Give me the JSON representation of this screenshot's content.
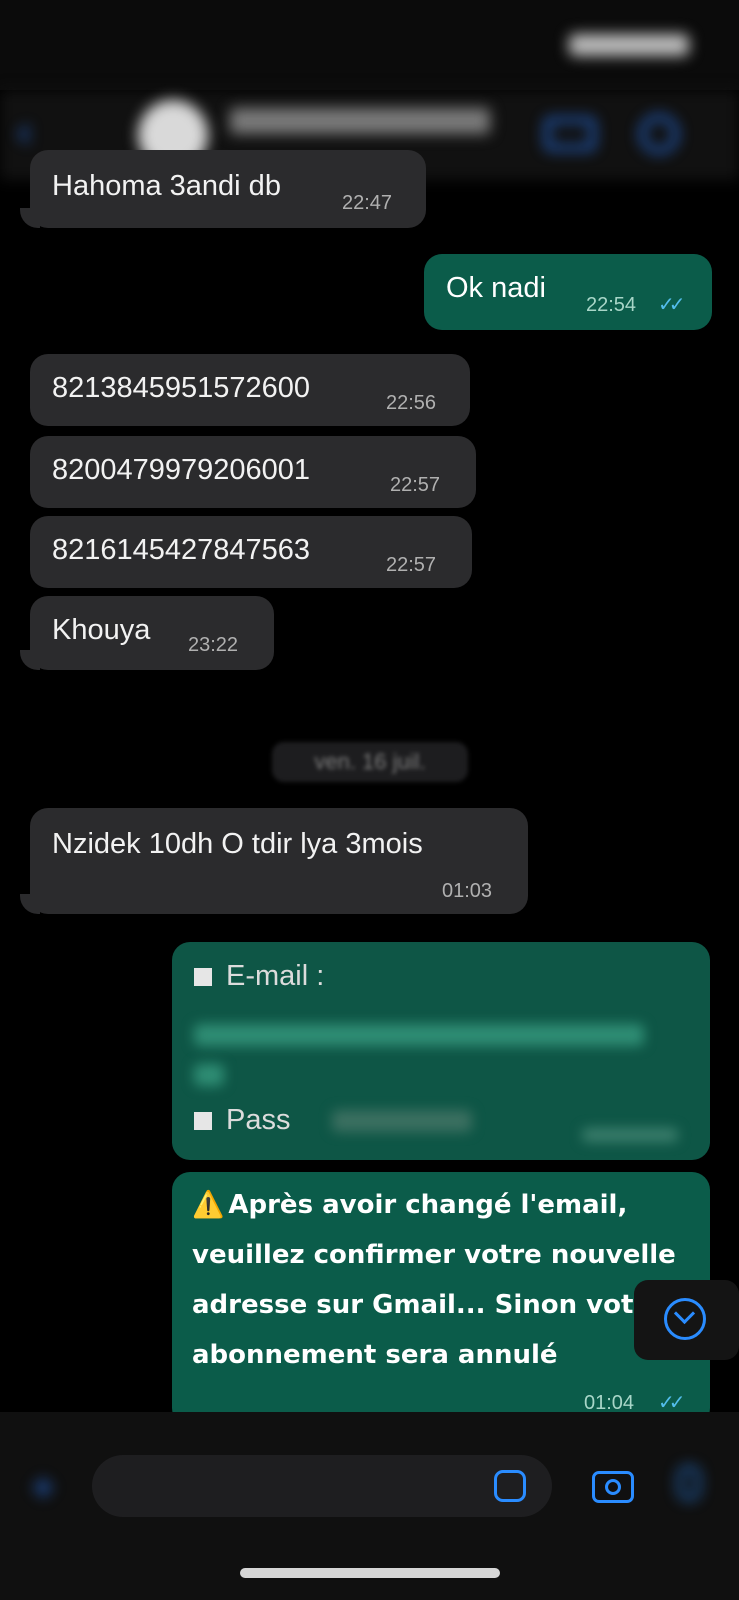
{
  "header": {
    "time": "",
    "contact_name": ""
  },
  "messages": [
    {
      "text": "Hahoma 3andi db",
      "time": "22:47",
      "direction": "in"
    },
    {
      "text": "Ok nadi",
      "time": "22:54",
      "direction": "out",
      "status": "read"
    },
    {
      "text": "8213845951572600",
      "time": "22:56",
      "direction": "in"
    },
    {
      "text": "8200479979206001",
      "time": "22:57",
      "direction": "in"
    },
    {
      "text": "8216145427847563",
      "time": "22:57",
      "direction": "in"
    },
    {
      "text": "Khouya",
      "time": "23:22",
      "direction": "in"
    }
  ],
  "date_separator": "ven. 16 juil.",
  "message_late": {
    "text": "Nzidek 10dh O tdir lya 3mois",
    "time": "01:03",
    "direction": "in"
  },
  "credentials_message": {
    "email_label": "E-mail :",
    "pass_label": "Pass"
  },
  "warning_message": {
    "icon": "⚠️",
    "line1": "Après avoir changé l'email,",
    "line2": "veuillez confirmer votre nouvelle",
    "line3": "adresse sur Gmail... Sinon votr",
    "line4": "abonnement sera annulé",
    "time": "01:04",
    "status": "read"
  },
  "icons": {
    "back": "back-chevron-icon",
    "video": "video-call-icon",
    "call": "phone-icon",
    "scroll": "scroll-down-icon",
    "plus": "plus-icon",
    "sticker": "sticker-icon",
    "camera": "camera-icon",
    "mic": "microphone-icon"
  },
  "colors": {
    "incoming_bubble": "#2b2b2d",
    "outgoing_bubble": "#0b5c4a",
    "accent": "#2a8cff",
    "read_ticks": "#53bdeb"
  }
}
